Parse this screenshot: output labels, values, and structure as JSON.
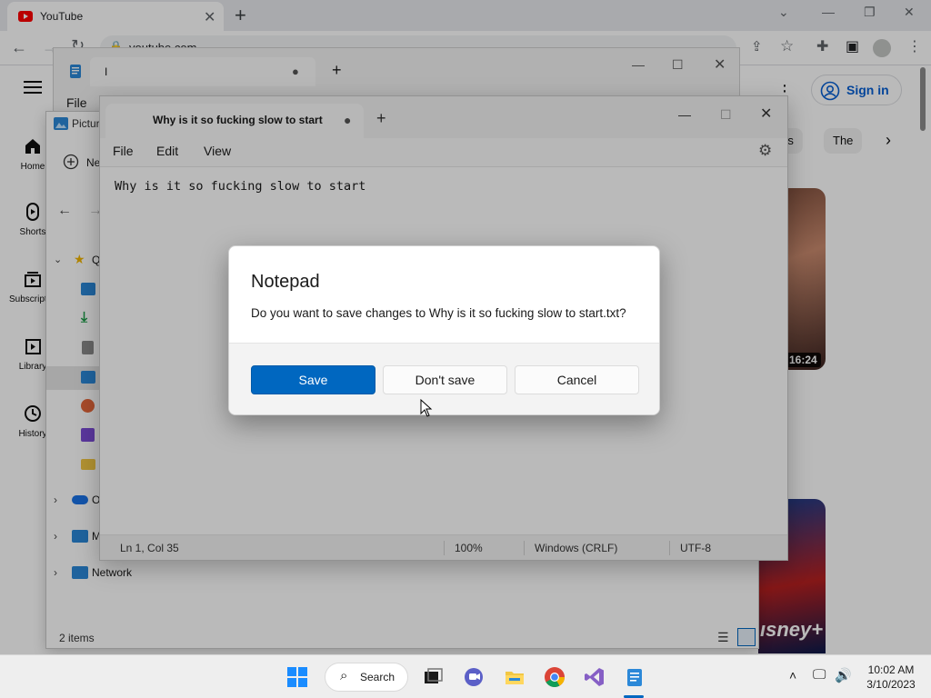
{
  "colors": {
    "accent": "#0067c0",
    "yt_red": "#ff0000",
    "yt_link": "#065fd4"
  },
  "chrome": {
    "tab_title": "YouTube",
    "url": "youtube.com",
    "icons": [
      "youtube-favicon",
      "back-icon",
      "forward-icon",
      "reload-icon",
      "lock-icon",
      "install-icon",
      "share-icon",
      "star-icon",
      "extensions-icon",
      "sidepanel-icon",
      "profile-icon",
      "kebab-icon"
    ]
  },
  "youtube": {
    "nav": [
      {
        "label": "Home",
        "icon": "home-icon"
      },
      {
        "label": "Shorts",
        "icon": "shorts-icon"
      },
      {
        "label": "Subscriptions",
        "icon": "subscriptions-icon"
      },
      {
        "label": "Library",
        "icon": "library-icon"
      },
      {
        "label": "History",
        "icon": "history-icon"
      }
    ],
    "sign_in": "Sign in",
    "chips": [
      "rs",
      "The"
    ],
    "video_duration": "16:24",
    "thumb_logo": "ısney+"
  },
  "explorer": {
    "title": "Pictur",
    "new_label": "Ne",
    "quick_access": "Q",
    "tree": [
      {
        "label": "O",
        "icon": "onedrive-icon"
      },
      {
        "label": "M",
        "icon": "this-pc-icon"
      },
      {
        "label": "Network",
        "icon": "network-icon"
      }
    ],
    "status": "2 items"
  },
  "notepad_back": {
    "tab_title": "I",
    "menu_file": "File"
  },
  "notepad": {
    "tab_title": "Why is it so fucking slow to start",
    "menu": [
      "File",
      "Edit",
      "View"
    ],
    "content": "Why is it so fucking slow to start",
    "status": {
      "position": "Ln 1, Col 35",
      "zoom": "100%",
      "line_ending": "Windows (CRLF)",
      "encoding": "UTF-8"
    }
  },
  "dialog": {
    "title": "Notepad",
    "message": "Do you want to save changes to Why is it so fucking slow to start.txt?",
    "save": "Save",
    "dont_save": "Don't save",
    "cancel": "Cancel"
  },
  "taskbar": {
    "search": "Search",
    "time": "10:02 AM",
    "date": "3/10/2023"
  }
}
